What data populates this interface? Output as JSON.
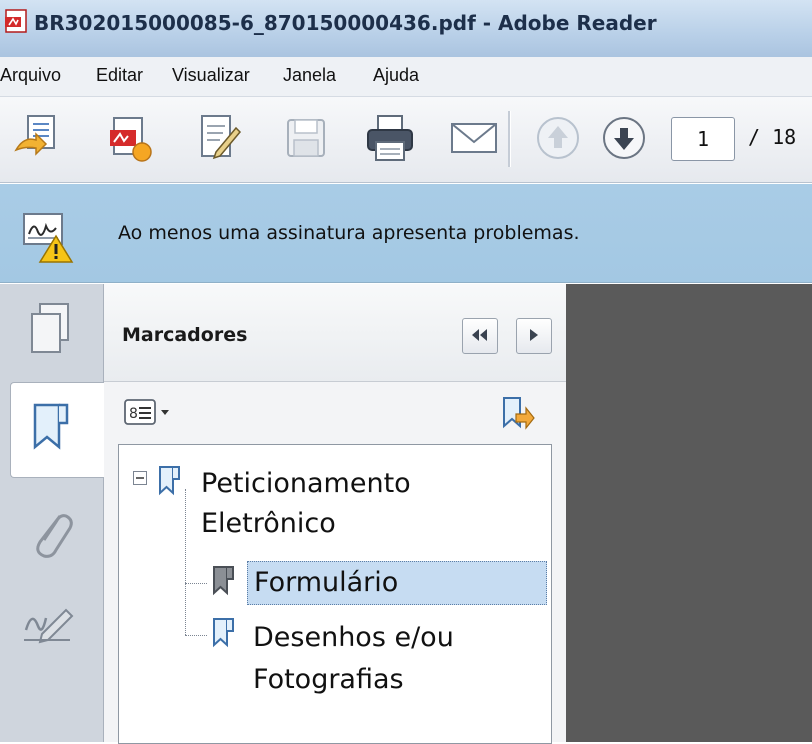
{
  "window": {
    "title": "BR302015000085-6_870150000436.pdf - Adobe Reader"
  },
  "menu": {
    "items": [
      "Arquivo",
      "Editar",
      "Visualizar",
      "Janela",
      "Ajuda"
    ]
  },
  "toolbar": {
    "icons": [
      "open-file-icon",
      "create-pdf-icon",
      "sign-document-icon",
      "save-icon",
      "print-icon",
      "email-icon",
      "previous-page-icon",
      "next-page-icon"
    ],
    "page_current": "1",
    "page_total": "/ 18"
  },
  "notification": {
    "message": "Ao menos uma assinatura apresenta problemas."
  },
  "bookmarks_panel": {
    "title": "Marcadores",
    "tree": [
      {
        "label_line1": "Peticionamento",
        "label_line2": "Eletrônico",
        "expanded": true
      },
      {
        "label": "Formulário",
        "selected": true
      },
      {
        "label_line1": "Desenhos e/ou",
        "label_line2": "Fotografias"
      }
    ]
  },
  "colors": {
    "notification_bg": "#a9cce6",
    "selected_bg": "#c6dcf2",
    "document_bg": "#5a5a5a"
  }
}
